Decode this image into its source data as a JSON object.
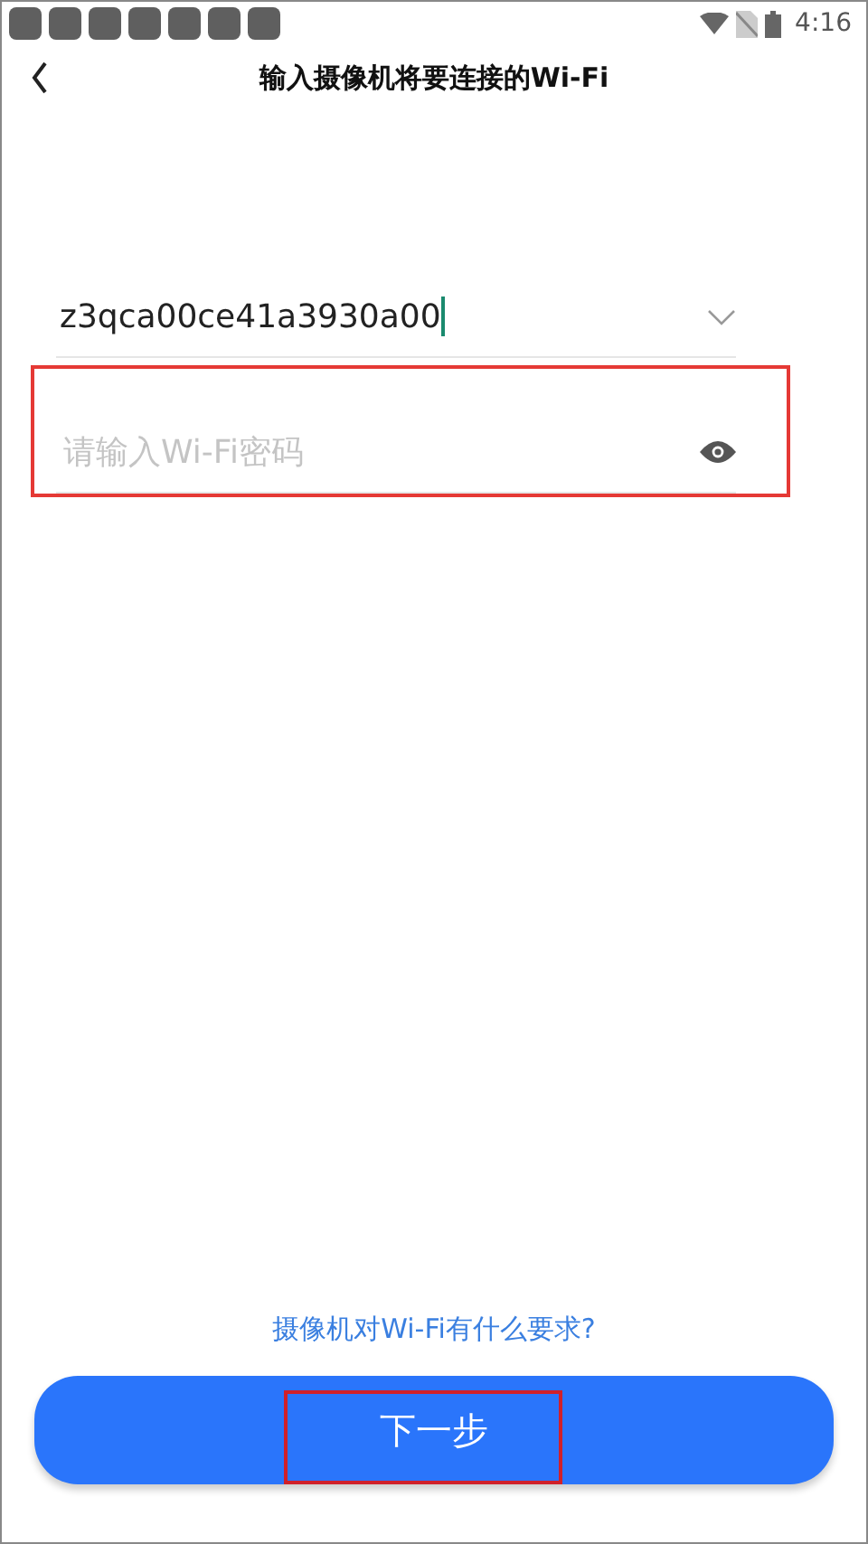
{
  "status_bar": {
    "time": "4:16"
  },
  "header": {
    "title": "输入摄像机将要连接的Wi-Fi"
  },
  "wifi_field": {
    "value": "z3qca00ce41a3930a00",
    "focused": true,
    "highlighted": false
  },
  "password_field": {
    "placeholder": "请输入Wi-Fi密码",
    "highlighted": true
  },
  "help_link": "摄像机对Wi-Fi有什么要求?",
  "next_button": {
    "label": "下一步",
    "highlighted": true
  }
}
